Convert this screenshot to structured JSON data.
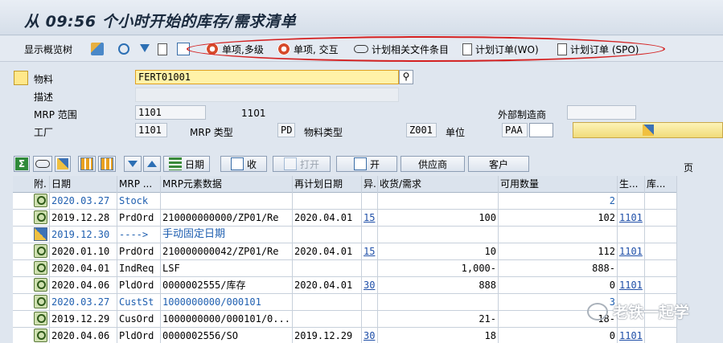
{
  "title": "从 09:56 个小时开始的库存/需求清单",
  "toolbar": {
    "show_tree": "显示概览树",
    "single_multi": "单项,多级",
    "single_interactive": "单项, 交互",
    "plan_docs": "计划相关文件条目",
    "plan_order_wo": "计划订单(WO)",
    "plan_order_spo": "计划订单 (SPO)"
  },
  "header": {
    "material_label": "物料",
    "material_value": "FERT01001",
    "desc_label": "描述",
    "mrp_area_label": "MRP 范围",
    "mrp_area_value": "1101",
    "mrp_area_text": "1101",
    "ext_proc_label": "外部制造商",
    "plant_label": "工厂",
    "plant_value": "1101",
    "mrp_type_label": "MRP 类型",
    "mrp_type_value": "PD",
    "mat_type_label": "物料类型",
    "mat_type_value": "Z001",
    "unit_label": "单位",
    "unit_value": "PAA"
  },
  "toolbar2": {
    "date_btn": "日期",
    "receipt_btn": "收",
    "open_btn": "打开",
    "open2_btn": "开",
    "vendor_btn": "供应商",
    "customer_btn": "客户",
    "page_label": "页"
  },
  "table": {
    "columns": [
      "附.",
      "日期",
      "MRP ...",
      "MRP元素数据",
      "再计划日期",
      "异.",
      "收货/需求",
      "可用数量",
      "生...",
      "库..."
    ],
    "rows": [
      {
        "icon": "lens",
        "date": "2020.03.27",
        "element": "Stock",
        "data": "",
        "resched": "",
        "exc": "",
        "qty": "",
        "avail": "2",
        "plant": "",
        "stor": "",
        "blue": true
      },
      {
        "icon": "lens",
        "date": "2019.12.28",
        "element": "PrdOrd",
        "data": "210000000000/ZP01/Re",
        "resched": "2020.04.01",
        "exc": "15",
        "qty": "100",
        "avail": "102",
        "plant": "1101",
        "stor": "",
        "blue": false
      },
      {
        "icon": "pencil",
        "date": "2019.12.30",
        "element": "---->",
        "data": "手动固定日期",
        "resched": "",
        "exc": "",
        "qty": "",
        "avail": "",
        "plant": "",
        "stor": "",
        "blue": true
      },
      {
        "icon": "lens",
        "date": "2020.01.10",
        "element": "PrdOrd",
        "data": "210000000042/ZP01/Re",
        "resched": "2020.04.01",
        "exc": "15",
        "qty": "10",
        "avail": "112",
        "plant": "1101",
        "stor": "",
        "blue": false
      },
      {
        "icon": "lens",
        "date": "2020.04.01",
        "element": "IndReq",
        "data": "LSF",
        "resched": "",
        "exc": "",
        "qty": "1,000-",
        "avail": "888-",
        "plant": "",
        "stor": "",
        "blue": false
      },
      {
        "icon": "lens",
        "date": "2020.04.06",
        "element": "PldOrd",
        "data": "0000002555/库存",
        "resched": "2020.04.01",
        "exc": "30",
        "qty": "888",
        "avail": "0",
        "plant": "1101",
        "stor": "",
        "blue": false
      },
      {
        "icon": "lens",
        "date": "2020.03.27",
        "element": "CustSt",
        "data": "1000000000/000101",
        "resched": "",
        "exc": "",
        "qty": "",
        "avail": "3",
        "plant": "",
        "stor": "",
        "blue": true
      },
      {
        "icon": "lens",
        "date": "2019.12.29",
        "element": "CusOrd",
        "data": "1000000000/000101/0...",
        "resched": "",
        "exc": "",
        "qty": "21-",
        "avail": "18-",
        "plant": "",
        "stor": "",
        "blue": false
      },
      {
        "icon": "lens",
        "date": "2020.04.06",
        "element": "PldOrd",
        "data": "0000002556/SO",
        "resched": "2019.12.29",
        "exc": "30",
        "qty": "18",
        "avail": "0",
        "plant": "1101",
        "stor": "",
        "blue": false
      }
    ]
  },
  "watermark": "老铁一起学"
}
